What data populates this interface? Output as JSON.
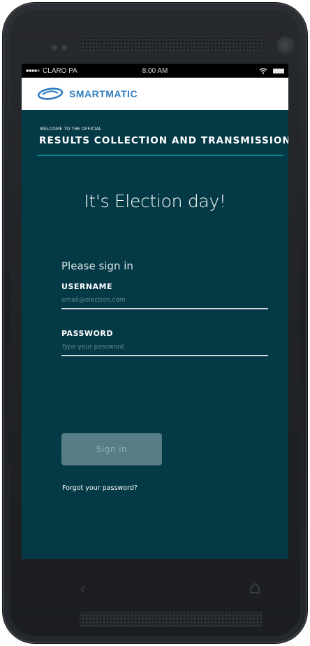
{
  "status_bar": {
    "carrier": "CLARO PA",
    "time": "8:00 AM",
    "wifi_icon": "wifi-icon",
    "battery_icon": "battery-icon"
  },
  "brand": {
    "name": "SMARTMATIC",
    "logo_icon": "smartmatic-logo-icon",
    "color": "#2f7cc1"
  },
  "header": {
    "welcome": "WELCOME TO THE OFFICIAL",
    "title": "RESULTS COLLECTION AND TRANSMISSION"
  },
  "main": {
    "headline": "It's Election day!",
    "prompt": "Please sign in"
  },
  "form": {
    "username_label": "USERNAME",
    "username_placeholder": "email@election.com",
    "username_value": "",
    "password_label": "PASSWORD",
    "password_placeholder": "Type your password",
    "password_value": "",
    "submit_label": "Sign in",
    "forgot_label": "Forgot your password?"
  },
  "colors": {
    "background": "#043946",
    "accent_divider": "#0d7d8f",
    "button": "#587d85"
  }
}
